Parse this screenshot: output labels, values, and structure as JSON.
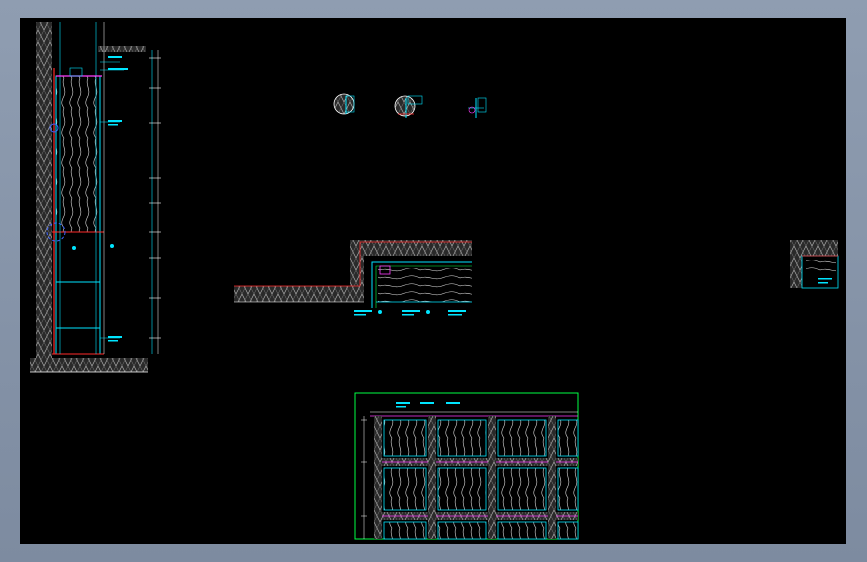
{
  "viewport": {
    "background": "#000000",
    "frame_color": "#8f9db1"
  },
  "colors": {
    "cyan": "#00e5ff",
    "red": "#ff2a2a",
    "magenta": "#ff3cff",
    "white": "#ffffff",
    "green": "#00ff44",
    "blue": "#3c64ff",
    "gray": "#9a9a9a"
  },
  "drawings": [
    {
      "id": "elevation-section",
      "description_label": ""
    },
    {
      "id": "detail-bubble-1",
      "description_label": ""
    },
    {
      "id": "detail-bubble-2",
      "description_label": ""
    },
    {
      "id": "detail-bubble-3",
      "description_label": ""
    },
    {
      "id": "wall-step-section",
      "description_label": ""
    },
    {
      "id": "corner-detail",
      "description_label": ""
    },
    {
      "id": "panel-elevation",
      "description_label": ""
    }
  ]
}
